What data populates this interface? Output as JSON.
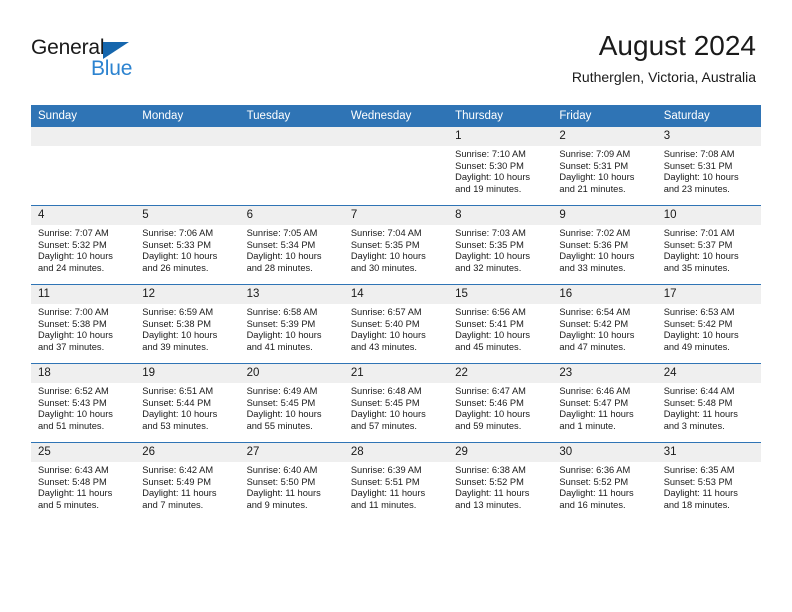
{
  "brand": {
    "name_part1": "General",
    "name_part2": "Blue",
    "triangle_icon": "blue-triangle-logo-mark",
    "color_dark": "#1a1a1a",
    "color_blue": "#2c83d0"
  },
  "header": {
    "title": "August 2024",
    "subtitle": "Rutherglen, Victoria, Australia"
  },
  "theme": {
    "header_bg": "#2f74b5",
    "header_text": "#ffffff",
    "daynum_bg": "#efefef",
    "rule_color": "#2f74b5"
  },
  "weekday_headers": [
    "Sunday",
    "Monday",
    "Tuesday",
    "Wednesday",
    "Thursday",
    "Friday",
    "Saturday"
  ],
  "weeks": [
    [
      {
        "day": "",
        "sunrise": "",
        "sunset": "",
        "daylight_line1": "",
        "daylight_line2": ""
      },
      {
        "day": "",
        "sunrise": "",
        "sunset": "",
        "daylight_line1": "",
        "daylight_line2": ""
      },
      {
        "day": "",
        "sunrise": "",
        "sunset": "",
        "daylight_line1": "",
        "daylight_line2": ""
      },
      {
        "day": "",
        "sunrise": "",
        "sunset": "",
        "daylight_line1": "",
        "daylight_line2": ""
      },
      {
        "day": "1",
        "sunrise": "Sunrise: 7:10 AM",
        "sunset": "Sunset: 5:30 PM",
        "daylight_line1": "Daylight: 10 hours",
        "daylight_line2": "and 19 minutes."
      },
      {
        "day": "2",
        "sunrise": "Sunrise: 7:09 AM",
        "sunset": "Sunset: 5:31 PM",
        "daylight_line1": "Daylight: 10 hours",
        "daylight_line2": "and 21 minutes."
      },
      {
        "day": "3",
        "sunrise": "Sunrise: 7:08 AM",
        "sunset": "Sunset: 5:31 PM",
        "daylight_line1": "Daylight: 10 hours",
        "daylight_line2": "and 23 minutes."
      }
    ],
    [
      {
        "day": "4",
        "sunrise": "Sunrise: 7:07 AM",
        "sunset": "Sunset: 5:32 PM",
        "daylight_line1": "Daylight: 10 hours",
        "daylight_line2": "and 24 minutes."
      },
      {
        "day": "5",
        "sunrise": "Sunrise: 7:06 AM",
        "sunset": "Sunset: 5:33 PM",
        "daylight_line1": "Daylight: 10 hours",
        "daylight_line2": "and 26 minutes."
      },
      {
        "day": "6",
        "sunrise": "Sunrise: 7:05 AM",
        "sunset": "Sunset: 5:34 PM",
        "daylight_line1": "Daylight: 10 hours",
        "daylight_line2": "and 28 minutes."
      },
      {
        "day": "7",
        "sunrise": "Sunrise: 7:04 AM",
        "sunset": "Sunset: 5:35 PM",
        "daylight_line1": "Daylight: 10 hours",
        "daylight_line2": "and 30 minutes."
      },
      {
        "day": "8",
        "sunrise": "Sunrise: 7:03 AM",
        "sunset": "Sunset: 5:35 PM",
        "daylight_line1": "Daylight: 10 hours",
        "daylight_line2": "and 32 minutes."
      },
      {
        "day": "9",
        "sunrise": "Sunrise: 7:02 AM",
        "sunset": "Sunset: 5:36 PM",
        "daylight_line1": "Daylight: 10 hours",
        "daylight_line2": "and 33 minutes."
      },
      {
        "day": "10",
        "sunrise": "Sunrise: 7:01 AM",
        "sunset": "Sunset: 5:37 PM",
        "daylight_line1": "Daylight: 10 hours",
        "daylight_line2": "and 35 minutes."
      }
    ],
    [
      {
        "day": "11",
        "sunrise": "Sunrise: 7:00 AM",
        "sunset": "Sunset: 5:38 PM",
        "daylight_line1": "Daylight: 10 hours",
        "daylight_line2": "and 37 minutes."
      },
      {
        "day": "12",
        "sunrise": "Sunrise: 6:59 AM",
        "sunset": "Sunset: 5:38 PM",
        "daylight_line1": "Daylight: 10 hours",
        "daylight_line2": "and 39 minutes."
      },
      {
        "day": "13",
        "sunrise": "Sunrise: 6:58 AM",
        "sunset": "Sunset: 5:39 PM",
        "daylight_line1": "Daylight: 10 hours",
        "daylight_line2": "and 41 minutes."
      },
      {
        "day": "14",
        "sunrise": "Sunrise: 6:57 AM",
        "sunset": "Sunset: 5:40 PM",
        "daylight_line1": "Daylight: 10 hours",
        "daylight_line2": "and 43 minutes."
      },
      {
        "day": "15",
        "sunrise": "Sunrise: 6:56 AM",
        "sunset": "Sunset: 5:41 PM",
        "daylight_line1": "Daylight: 10 hours",
        "daylight_line2": "and 45 minutes."
      },
      {
        "day": "16",
        "sunrise": "Sunrise: 6:54 AM",
        "sunset": "Sunset: 5:42 PM",
        "daylight_line1": "Daylight: 10 hours",
        "daylight_line2": "and 47 minutes."
      },
      {
        "day": "17",
        "sunrise": "Sunrise: 6:53 AM",
        "sunset": "Sunset: 5:42 PM",
        "daylight_line1": "Daylight: 10 hours",
        "daylight_line2": "and 49 minutes."
      }
    ],
    [
      {
        "day": "18",
        "sunrise": "Sunrise: 6:52 AM",
        "sunset": "Sunset: 5:43 PM",
        "daylight_line1": "Daylight: 10 hours",
        "daylight_line2": "and 51 minutes."
      },
      {
        "day": "19",
        "sunrise": "Sunrise: 6:51 AM",
        "sunset": "Sunset: 5:44 PM",
        "daylight_line1": "Daylight: 10 hours",
        "daylight_line2": "and 53 minutes."
      },
      {
        "day": "20",
        "sunrise": "Sunrise: 6:49 AM",
        "sunset": "Sunset: 5:45 PM",
        "daylight_line1": "Daylight: 10 hours",
        "daylight_line2": "and 55 minutes."
      },
      {
        "day": "21",
        "sunrise": "Sunrise: 6:48 AM",
        "sunset": "Sunset: 5:45 PM",
        "daylight_line1": "Daylight: 10 hours",
        "daylight_line2": "and 57 minutes."
      },
      {
        "day": "22",
        "sunrise": "Sunrise: 6:47 AM",
        "sunset": "Sunset: 5:46 PM",
        "daylight_line1": "Daylight: 10 hours",
        "daylight_line2": "and 59 minutes."
      },
      {
        "day": "23",
        "sunrise": "Sunrise: 6:46 AM",
        "sunset": "Sunset: 5:47 PM",
        "daylight_line1": "Daylight: 11 hours",
        "daylight_line2": "and 1 minute."
      },
      {
        "day": "24",
        "sunrise": "Sunrise: 6:44 AM",
        "sunset": "Sunset: 5:48 PM",
        "daylight_line1": "Daylight: 11 hours",
        "daylight_line2": "and 3 minutes."
      }
    ],
    [
      {
        "day": "25",
        "sunrise": "Sunrise: 6:43 AM",
        "sunset": "Sunset: 5:48 PM",
        "daylight_line1": "Daylight: 11 hours",
        "daylight_line2": "and 5 minutes."
      },
      {
        "day": "26",
        "sunrise": "Sunrise: 6:42 AM",
        "sunset": "Sunset: 5:49 PM",
        "daylight_line1": "Daylight: 11 hours",
        "daylight_line2": "and 7 minutes."
      },
      {
        "day": "27",
        "sunrise": "Sunrise: 6:40 AM",
        "sunset": "Sunset: 5:50 PM",
        "daylight_line1": "Daylight: 11 hours",
        "daylight_line2": "and 9 minutes."
      },
      {
        "day": "28",
        "sunrise": "Sunrise: 6:39 AM",
        "sunset": "Sunset: 5:51 PM",
        "daylight_line1": "Daylight: 11 hours",
        "daylight_line2": "and 11 minutes."
      },
      {
        "day": "29",
        "sunrise": "Sunrise: 6:38 AM",
        "sunset": "Sunset: 5:52 PM",
        "daylight_line1": "Daylight: 11 hours",
        "daylight_line2": "and 13 minutes."
      },
      {
        "day": "30",
        "sunrise": "Sunrise: 6:36 AM",
        "sunset": "Sunset: 5:52 PM",
        "daylight_line1": "Daylight: 11 hours",
        "daylight_line2": "and 16 minutes."
      },
      {
        "day": "31",
        "sunrise": "Sunrise: 6:35 AM",
        "sunset": "Sunset: 5:53 PM",
        "daylight_line1": "Daylight: 11 hours",
        "daylight_line2": "and 18 minutes."
      }
    ]
  ]
}
